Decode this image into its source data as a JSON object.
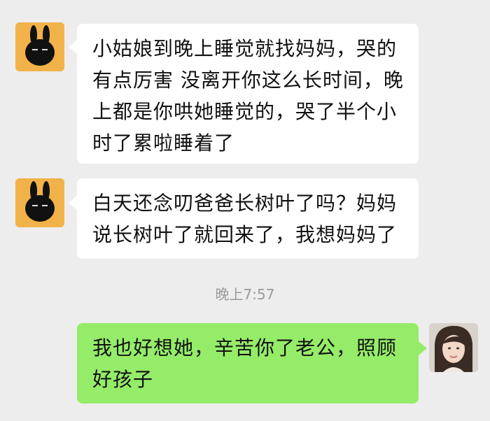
{
  "chat": {
    "messages": [
      {
        "sender": "contact",
        "text": "小姑娘到晚上睡觉就找妈妈，哭的有点厉害 没离开你这么长时间，晚上都是你哄她睡觉的，哭了半个小时了累啦睡着了"
      },
      {
        "sender": "contact",
        "text": "白天还念叨爸爸长树叶了吗？妈妈说长树叶了就回来了，我想妈妈了"
      },
      {
        "sender": "me",
        "text": "我也好想她，辛苦你了老公，照顾好孩子"
      }
    ],
    "timestamp": "晚上7:57"
  },
  "colors": {
    "background": "#ededed",
    "incoming_bubble": "#ffffff",
    "outgoing_bubble": "#95ec69",
    "rabbit_avatar": "#f2b24a"
  },
  "icons": {
    "contact_avatar": "black-rabbit-avatar-icon",
    "user_avatar": "user-photo-avatar"
  }
}
